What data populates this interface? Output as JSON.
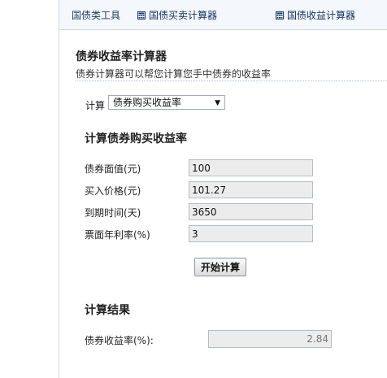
{
  "topbar": {
    "tools_label": "国债类工具",
    "links": [
      {
        "label": "国债买卖计算器",
        "icon": "calculator-icon"
      },
      {
        "label": "国债收益计算器",
        "icon": "calculator-icon"
      }
    ]
  },
  "calculator": {
    "title": "债券收益率计算器",
    "subtitle": "债券计算器可以帮您计算您手中债券的收益率",
    "calc_label": "计算",
    "select": {
      "selected": "债券购买收益率"
    },
    "section_title": "计算债券购买收益率",
    "fields": [
      {
        "label": "债券面值(元)",
        "value": "100"
      },
      {
        "label": "买入价格(元)",
        "value": "101.27"
      },
      {
        "label": "到期时间(天)",
        "value": "3650"
      },
      {
        "label": "票面年利率(%)",
        "value": "3"
      }
    ],
    "start_button": "开始计算",
    "result_title": "计算结果",
    "result": {
      "label": "债券收益率(%):",
      "value": "2.84"
    }
  }
}
